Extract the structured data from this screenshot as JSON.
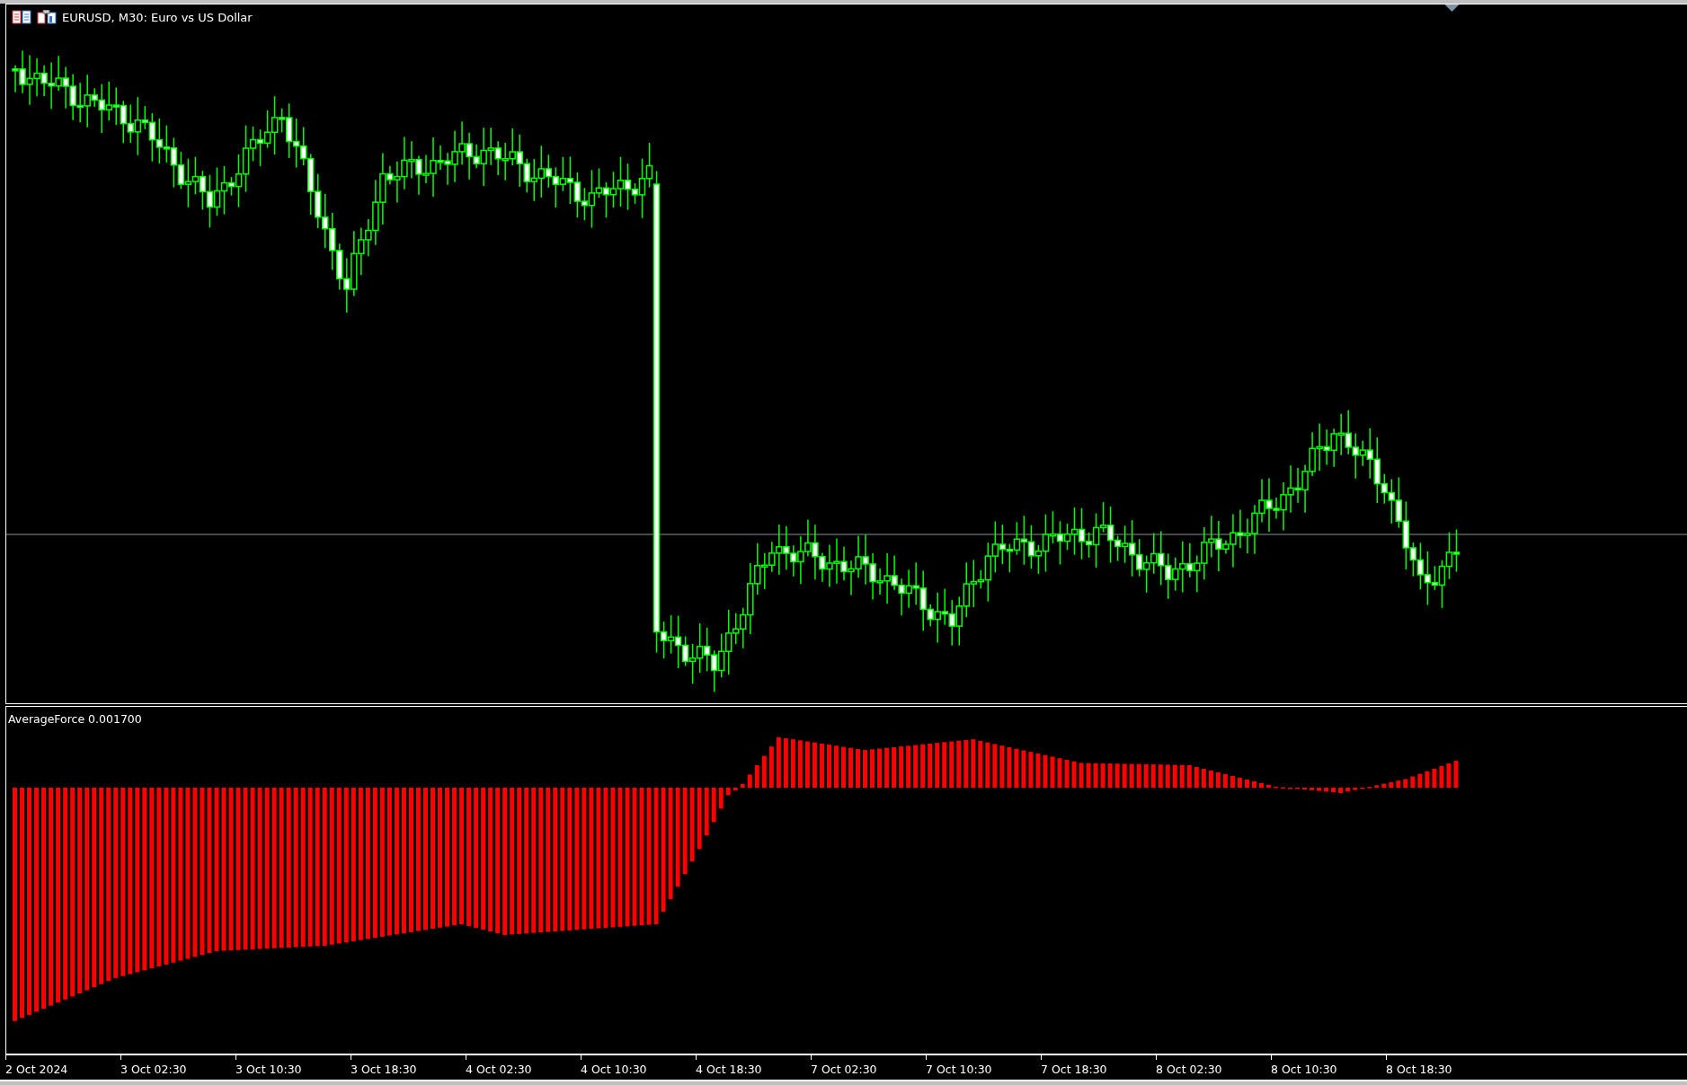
{
  "chart": {
    "title": "EURUSD, M30:  Euro vs US Dollar"
  },
  "indicator": {
    "label": "AverageForce 0.001700"
  },
  "time_axis": {
    "labels": [
      "2 Oct 2024",
      "3 Oct 02:30",
      "3 Oct 10:30",
      "3 Oct 18:30",
      "4 Oct 02:30",
      "4 Oct 10:30",
      "4 Oct 18:30",
      "7 Oct 02:30",
      "7 Oct 10:30",
      "7 Oct 18:30",
      "8 Oct 02:30",
      "8 Oct 10:30",
      "8 Oct 18:30"
    ]
  }
}
